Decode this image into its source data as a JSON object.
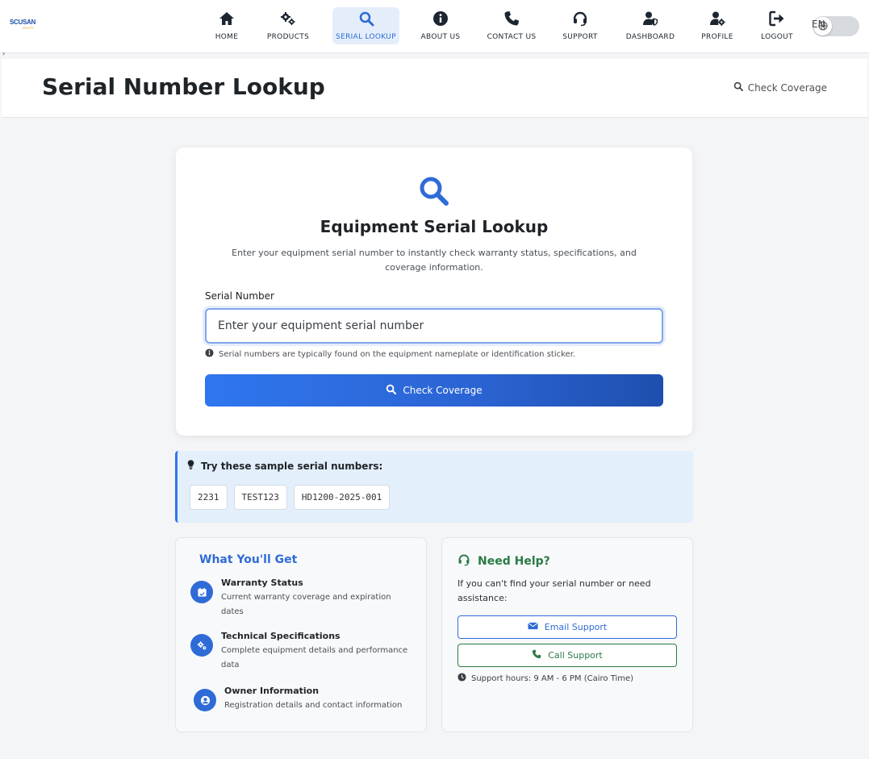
{
  "brand": {
    "line1": "SCUSAN",
    "line2": "EGYPT"
  },
  "nav": {
    "items": [
      {
        "label": "HOME",
        "icon": "home-icon"
      },
      {
        "label": "PRODUCTS",
        "icon": "cogs-icon"
      },
      {
        "label": "SERIAL LOOKUP",
        "icon": "search-icon",
        "active": true
      },
      {
        "label": "ABOUT US",
        "icon": "info-circle-icon"
      },
      {
        "label": "CONTACT US",
        "icon": "phone-icon"
      },
      {
        "label": "SUPPORT",
        "icon": "headset-icon"
      },
      {
        "label": "DASHBOARD",
        "icon": "user-shield-icon"
      },
      {
        "label": "PROFILE",
        "icon": "user-cog-icon"
      },
      {
        "label": "LOGOUT",
        "icon": "sign-out-icon"
      }
    ],
    "lang_label": "EN"
  },
  "header": {
    "title": "Serial Number Lookup",
    "link_label": "Check Coverage"
  },
  "lookup": {
    "title": "Equipment Serial Lookup",
    "subtitle": "Enter your equipment serial number to instantly check warranty status, specifications, and coverage information.",
    "field_label": "Serial Number",
    "placeholder": "Enter your equipment serial number",
    "value": "",
    "hint": "Serial numbers are typically found on the equipment nameplate or identification sticker.",
    "button_label": "Check Coverage"
  },
  "samples": {
    "title": "Try these sample serial numbers:",
    "items": [
      "2231",
      "TEST123",
      "HD1200-2025-001"
    ]
  },
  "benefits": {
    "title": "What You'll Get",
    "items": [
      {
        "title": "Warranty Status",
        "desc": "Current warranty coverage and expiration dates",
        "icon": "calendar-check-icon"
      },
      {
        "title": "Technical Specifications",
        "desc": "Complete equipment details and performance data",
        "icon": "cogs-icon"
      },
      {
        "title": "Owner Information",
        "desc": "Registration details and contact information",
        "icon": "user-circle-icon"
      }
    ]
  },
  "help": {
    "title": "Need Help?",
    "text": "If you can't find your serial number or need assistance:",
    "email_label": "Email Support",
    "call_label": "Call Support",
    "hours": "Support hours: 9 AM - 6 PM (Cairo Time)"
  },
  "colors": {
    "primary": "#2f6bd7",
    "success": "#2a7a45",
    "info_bg": "#e3effb"
  }
}
